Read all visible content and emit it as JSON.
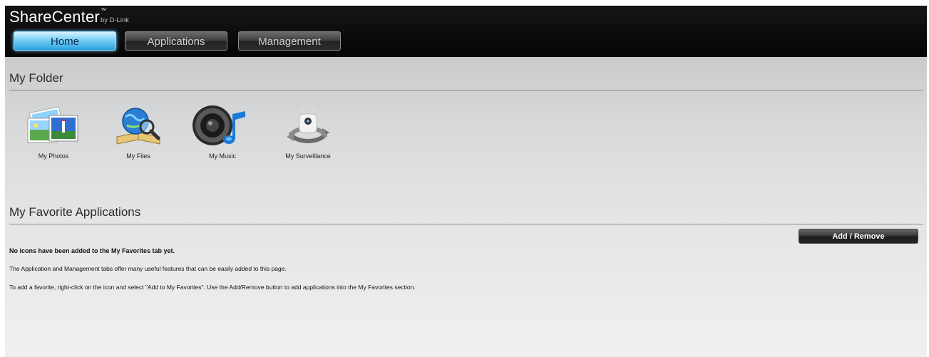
{
  "header": {
    "app_name": "ShareCenter",
    "trademark": "™",
    "by_line": "by D-Link",
    "tabs": [
      {
        "label": "Home",
        "active": true
      },
      {
        "label": "Applications",
        "active": false
      },
      {
        "label": "Management",
        "active": false
      }
    ]
  },
  "my_folder": {
    "title": "My Folder",
    "items": [
      {
        "label": "My Photos",
        "icon": "photos-icon"
      },
      {
        "label": "My Files",
        "icon": "files-globe-book-icon"
      },
      {
        "label": "My Music",
        "icon": "music-speaker-icon"
      },
      {
        "label": "My Surveillance",
        "icon": "surveillance-camera-icon"
      }
    ]
  },
  "favorites": {
    "title": "My Favorite Applications",
    "add_remove_label": "Add / Remove",
    "empty_message": "No icons have been added to the My Favorites tab yet.",
    "info_line_1": "The Application and Management tabs offer many useful features that can be easily added to this page.",
    "info_line_2": "To add a favorite, right-click on the icon and select \"Add to My Favorites\". Use the Add/Remove button to add applications into the My Favorites section."
  },
  "colors": {
    "header_bg": "#0a0a0a",
    "active_tab": "#5cc0f0",
    "content_bg": "#d8dadb"
  }
}
